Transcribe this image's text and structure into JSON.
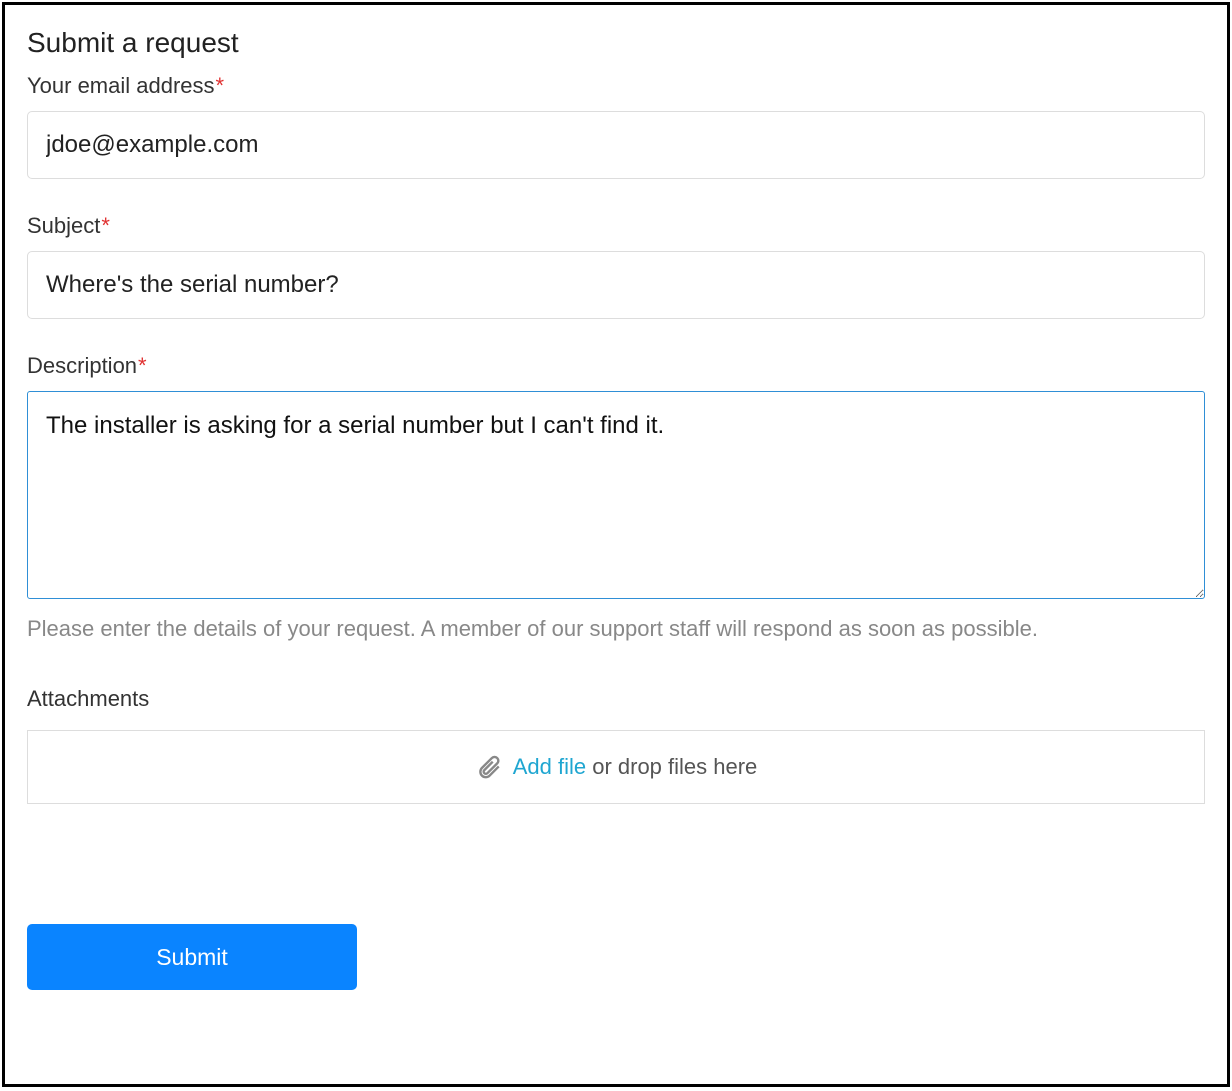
{
  "page": {
    "title": "Submit a request"
  },
  "form": {
    "email": {
      "label": "Your email address",
      "required": "*",
      "value": "jdoe@example.com"
    },
    "subject": {
      "label": "Subject",
      "required": "*",
      "value": "Where's the serial number?"
    },
    "description": {
      "label": "Description",
      "required": "*",
      "value": "The installer is asking for a serial number but I can't find it.",
      "helper": "Please enter the details of your request. A member of our support staff will respond as soon as possible."
    },
    "attachments": {
      "label": "Attachments",
      "link_text": "Add file",
      "suffix_text": " or drop files here"
    },
    "submit_label": "Submit"
  }
}
